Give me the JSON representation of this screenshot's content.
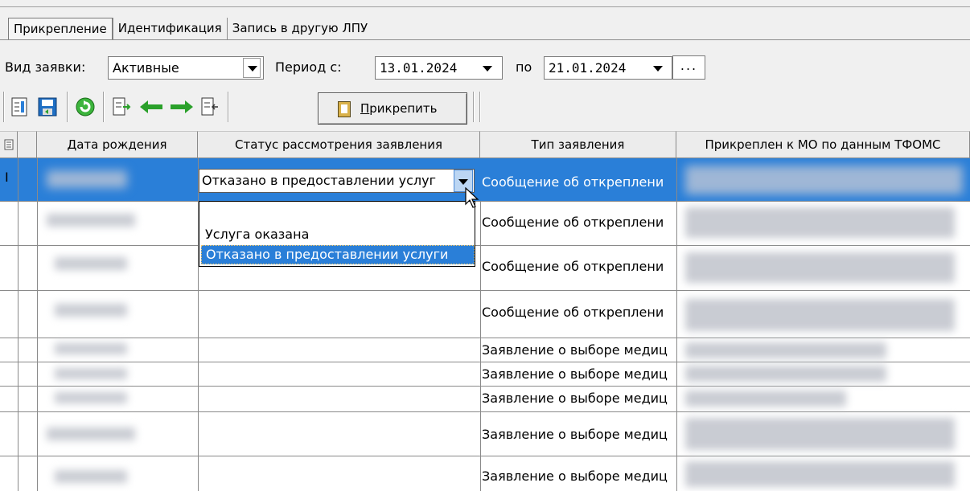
{
  "tabs": [
    "Прикрепление",
    "Идентификация",
    "Запись в другую ЛПУ"
  ],
  "filters": {
    "request_type_label": "Вид заявки:",
    "request_type_value": "Активные",
    "period_from_label": "Период с:",
    "period_from_value": "13.01.2024",
    "period_to_label": "по",
    "period_to_value": "21.01.2024",
    "more_button": "..."
  },
  "toolbar": {
    "attach_button": {
      "hotkey": "П",
      "rest": "рикрепить"
    },
    "icons": [
      "list-icon",
      "save-icon",
      "refresh-icon",
      "export-icon",
      "arrow-left-icon",
      "arrow-right-icon",
      "import-icon"
    ]
  },
  "grid": {
    "columns": [
      "Дата рождения",
      "Статус рассмотрения заявления",
      "Тип заявления",
      "Прикреплен к МО по данным ТФОМС"
    ],
    "row_indicator": "I",
    "editing": {
      "status_value": "Отказано в предоставлении услуг",
      "options": [
        "Услуга оказана",
        "Отказано в предоставлении услуги"
      ],
      "selected_option": "Отказано в предоставлении услуги"
    },
    "types": [
      "Сообщение об откреплени",
      "Сообщение об откреплени",
      "Сообщение об откреплени",
      "Сообщение об откреплени",
      "Заявление о выборе медиц",
      "Заявление о выборе медиц",
      "Заявление о выборе медиц",
      "Заявление о выборе медиц",
      "Заявление о выборе медиц"
    ]
  },
  "colors": {
    "selection": "#2a7fd8",
    "header_bg": "#ececec",
    "window_bg": "#f0f0f0"
  }
}
